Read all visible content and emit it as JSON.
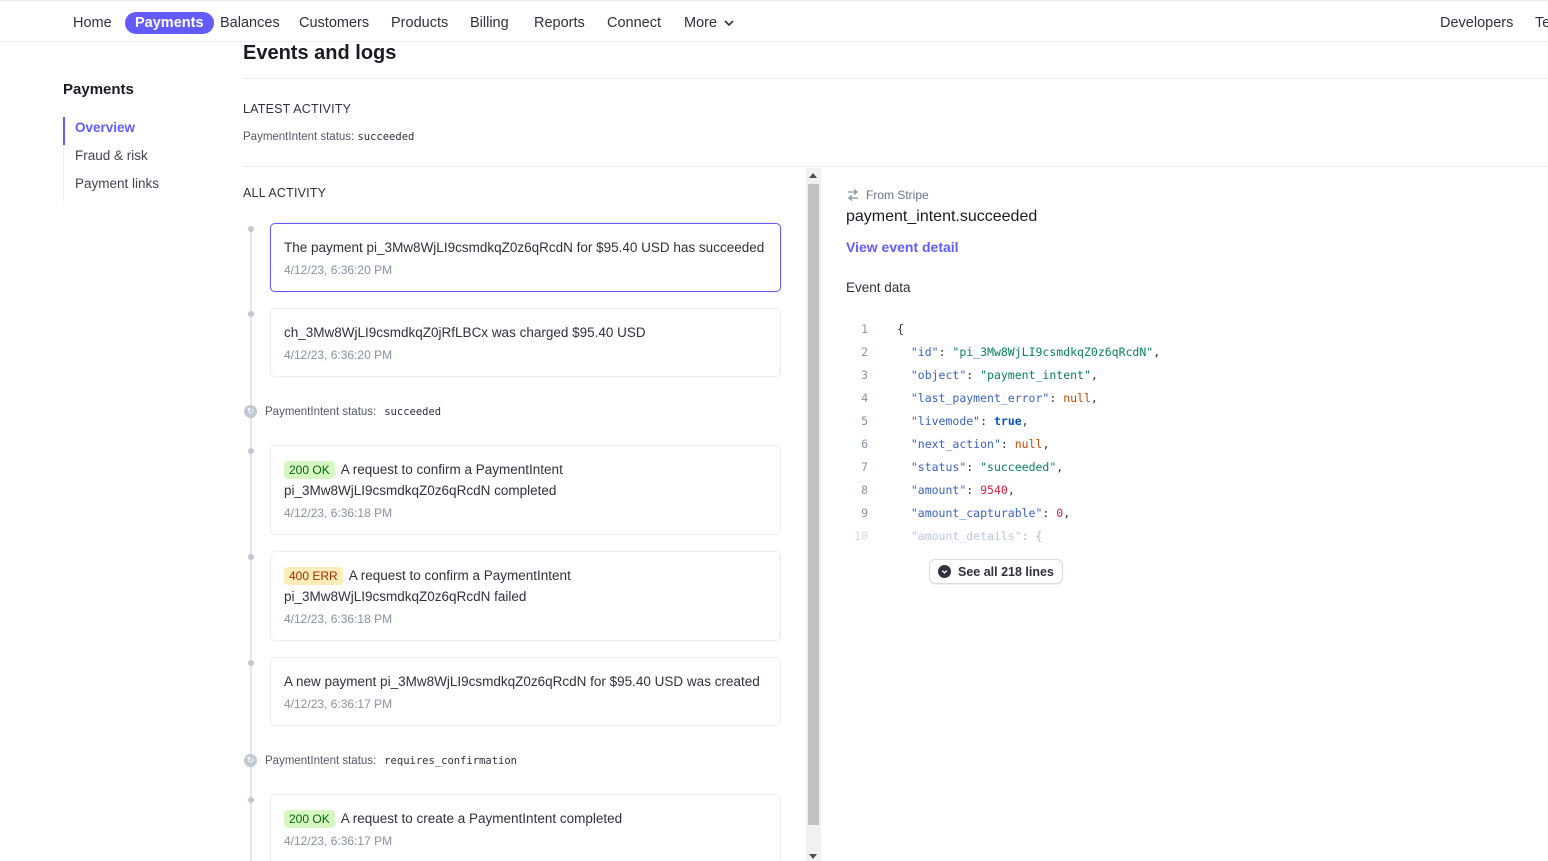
{
  "nav": {
    "items": [
      {
        "label": "Home"
      },
      {
        "label": "Payments"
      },
      {
        "label": "Balances"
      },
      {
        "label": "Customers"
      },
      {
        "label": "Products"
      },
      {
        "label": "Billing"
      },
      {
        "label": "Reports"
      },
      {
        "label": "Connect"
      },
      {
        "label": "More"
      }
    ],
    "active": "Payments",
    "right_items": [
      "Developers",
      "Te"
    ]
  },
  "page": {
    "title": "Events and logs"
  },
  "sidebar": {
    "title": "Payments",
    "items": [
      {
        "label": "Overview",
        "active": true
      },
      {
        "label": "Fraud & risk"
      },
      {
        "label": "Payment links"
      }
    ]
  },
  "latest": {
    "label": "LATEST ACTIVITY",
    "status_prefix": "PaymentIntent status:",
    "status_value": "succeeded"
  },
  "activity": {
    "label": "ALL ACTIVITY",
    "events": [
      {
        "text": "The payment pi_3Mw8WjLI9csmdkqZ0z6qRcdN for $95.40 USD has succeeded",
        "time": "4/12/23, 6:36:20 PM"
      },
      {
        "text": "ch_3Mw8WjLI9csmdkqZ0jRfLBCx was charged $95.40 USD",
        "time": "4/12/23, 6:36:20 PM"
      },
      {
        "badge": "200 OK",
        "text": "A request to confirm a PaymentIntent pi_3Mw8WjLI9csmdkqZ0z6qRcdN completed",
        "time": "4/12/23, 6:36:18 PM"
      },
      {
        "badge": "400 ERR",
        "text": "A request to confirm a PaymentIntent pi_3Mw8WjLI9csmdkqZ0z6qRcdN failed",
        "time": "4/12/23, 6:36:18 PM"
      },
      {
        "text": "A new payment pi_3Mw8WjLI9csmdkqZ0z6qRcdN for $95.40 USD was created",
        "time": "4/12/23, 6:36:17 PM"
      },
      {
        "badge": "200 OK",
        "text": "A request to create a PaymentIntent completed",
        "time": "4/12/23, 6:36:17 PM"
      }
    ],
    "status_markers": [
      {
        "prefix": "PaymentIntent status:",
        "value": "succeeded"
      },
      {
        "prefix": "PaymentIntent status:",
        "value": "requires_confirmation"
      }
    ]
  },
  "detail": {
    "source": "From Stripe",
    "event_type": "payment_intent.succeeded",
    "view_link": "View event detail",
    "data_label": "Event data",
    "code_lines": [
      {
        "n": "1",
        "text": "{"
      },
      {
        "n": "2",
        "key": "\"id\"",
        "val": "\"pi_3Mw8WjLI9csmdkqZ0z6qRcdN\"",
        "vtype": "s"
      },
      {
        "n": "3",
        "key": "\"object\"",
        "val": "\"payment_intent\"",
        "vtype": "s"
      },
      {
        "n": "4",
        "key": "\"last_payment_error\"",
        "val": "null",
        "vtype": "nl"
      },
      {
        "n": "5",
        "key": "\"livemode\"",
        "val": "true",
        "vtype": "b"
      },
      {
        "n": "6",
        "key": "\"next_action\"",
        "val": "null",
        "vtype": "nl"
      },
      {
        "n": "7",
        "key": "\"status\"",
        "val": "\"succeeded\"",
        "vtype": "s"
      },
      {
        "n": "8",
        "key": "\"amount\"",
        "val": "9540",
        "vtype": "n"
      },
      {
        "n": "9",
        "key": "\"amount_capturable\"",
        "val": "0",
        "vtype": "n"
      },
      {
        "n": "10",
        "key": "\"amount_details\"",
        "val": "{",
        "vtype": "p"
      }
    ],
    "see_all": "See all 218 lines"
  }
}
